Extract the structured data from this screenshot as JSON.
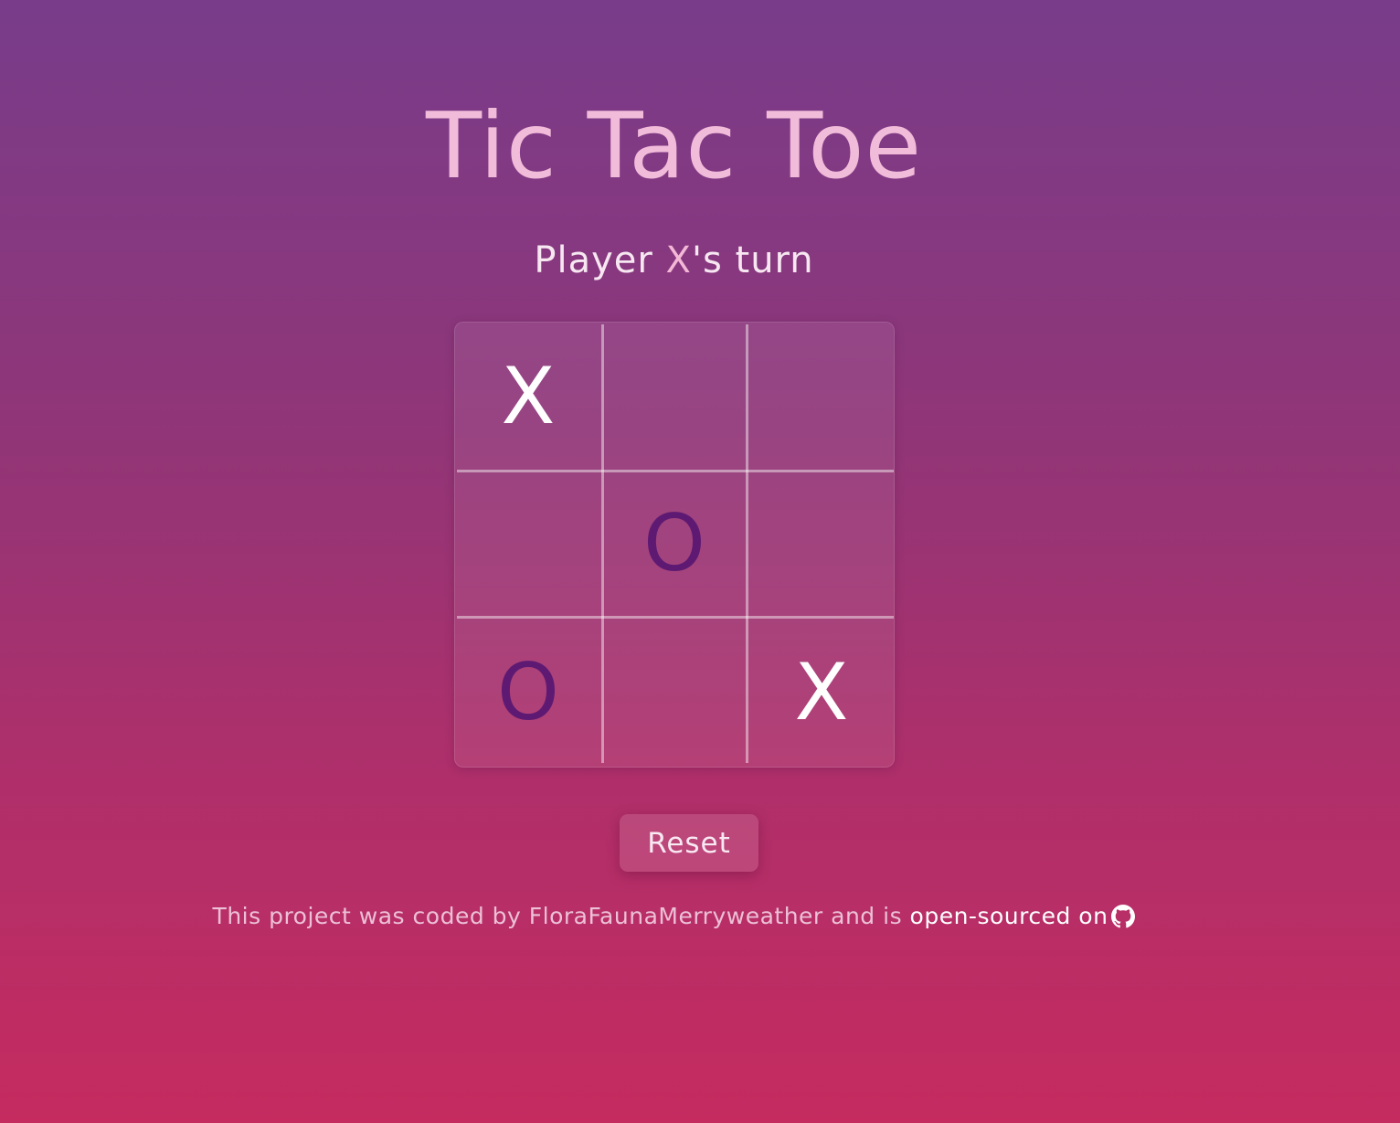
{
  "title": "Tic Tac Toe",
  "status": {
    "prefix": "Player ",
    "player": "X",
    "suffix": "'s turn"
  },
  "board": {
    "cells": [
      "X",
      "",
      "",
      "",
      "O",
      "",
      "O",
      "",
      "X"
    ]
  },
  "reset_label": "Reset",
  "footer": {
    "text": "This project was coded by FloraFaunaMerryweather and is ",
    "link_text": "open-sourced on",
    "icon": "github-icon"
  },
  "colors": {
    "title": "#f1bcd9",
    "player_highlight": "#f3b8d6",
    "x_mark": "#ffffff",
    "o_mark": "#5e1a72",
    "background_top": "#783c8a",
    "background_bottom": "#c52b5f"
  }
}
